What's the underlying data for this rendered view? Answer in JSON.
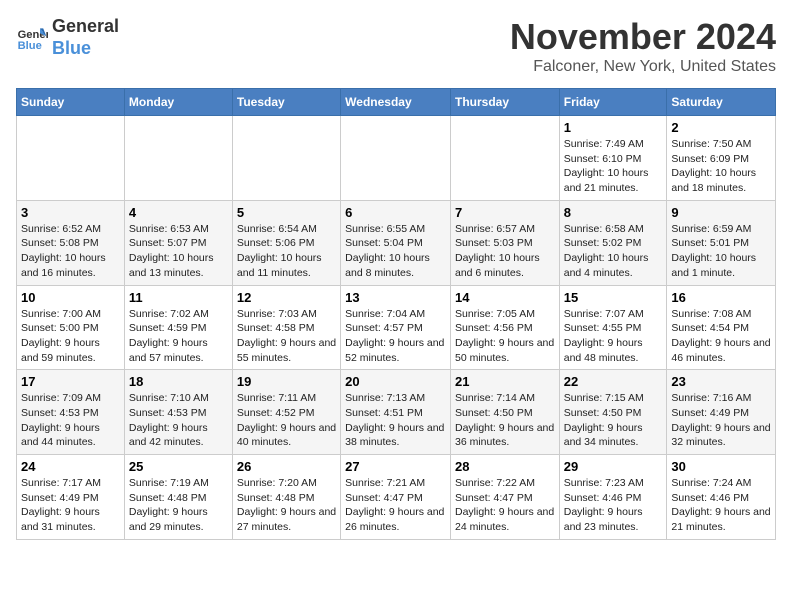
{
  "header": {
    "logo_line1": "General",
    "logo_line2": "Blue",
    "month": "November 2024",
    "location": "Falconer, New York, United States"
  },
  "weekdays": [
    "Sunday",
    "Monday",
    "Tuesday",
    "Wednesday",
    "Thursday",
    "Friday",
    "Saturday"
  ],
  "weeks": [
    [
      {
        "day": "",
        "info": ""
      },
      {
        "day": "",
        "info": ""
      },
      {
        "day": "",
        "info": ""
      },
      {
        "day": "",
        "info": ""
      },
      {
        "day": "",
        "info": ""
      },
      {
        "day": "1",
        "info": "Sunrise: 7:49 AM\nSunset: 6:10 PM\nDaylight: 10 hours and 21 minutes."
      },
      {
        "day": "2",
        "info": "Sunrise: 7:50 AM\nSunset: 6:09 PM\nDaylight: 10 hours and 18 minutes."
      }
    ],
    [
      {
        "day": "3",
        "info": "Sunrise: 6:52 AM\nSunset: 5:08 PM\nDaylight: 10 hours and 16 minutes."
      },
      {
        "day": "4",
        "info": "Sunrise: 6:53 AM\nSunset: 5:07 PM\nDaylight: 10 hours and 13 minutes."
      },
      {
        "day": "5",
        "info": "Sunrise: 6:54 AM\nSunset: 5:06 PM\nDaylight: 10 hours and 11 minutes."
      },
      {
        "day": "6",
        "info": "Sunrise: 6:55 AM\nSunset: 5:04 PM\nDaylight: 10 hours and 8 minutes."
      },
      {
        "day": "7",
        "info": "Sunrise: 6:57 AM\nSunset: 5:03 PM\nDaylight: 10 hours and 6 minutes."
      },
      {
        "day": "8",
        "info": "Sunrise: 6:58 AM\nSunset: 5:02 PM\nDaylight: 10 hours and 4 minutes."
      },
      {
        "day": "9",
        "info": "Sunrise: 6:59 AM\nSunset: 5:01 PM\nDaylight: 10 hours and 1 minute."
      }
    ],
    [
      {
        "day": "10",
        "info": "Sunrise: 7:00 AM\nSunset: 5:00 PM\nDaylight: 9 hours and 59 minutes."
      },
      {
        "day": "11",
        "info": "Sunrise: 7:02 AM\nSunset: 4:59 PM\nDaylight: 9 hours and 57 minutes."
      },
      {
        "day": "12",
        "info": "Sunrise: 7:03 AM\nSunset: 4:58 PM\nDaylight: 9 hours and 55 minutes."
      },
      {
        "day": "13",
        "info": "Sunrise: 7:04 AM\nSunset: 4:57 PM\nDaylight: 9 hours and 52 minutes."
      },
      {
        "day": "14",
        "info": "Sunrise: 7:05 AM\nSunset: 4:56 PM\nDaylight: 9 hours and 50 minutes."
      },
      {
        "day": "15",
        "info": "Sunrise: 7:07 AM\nSunset: 4:55 PM\nDaylight: 9 hours and 48 minutes."
      },
      {
        "day": "16",
        "info": "Sunrise: 7:08 AM\nSunset: 4:54 PM\nDaylight: 9 hours and 46 minutes."
      }
    ],
    [
      {
        "day": "17",
        "info": "Sunrise: 7:09 AM\nSunset: 4:53 PM\nDaylight: 9 hours and 44 minutes."
      },
      {
        "day": "18",
        "info": "Sunrise: 7:10 AM\nSunset: 4:53 PM\nDaylight: 9 hours and 42 minutes."
      },
      {
        "day": "19",
        "info": "Sunrise: 7:11 AM\nSunset: 4:52 PM\nDaylight: 9 hours and 40 minutes."
      },
      {
        "day": "20",
        "info": "Sunrise: 7:13 AM\nSunset: 4:51 PM\nDaylight: 9 hours and 38 minutes."
      },
      {
        "day": "21",
        "info": "Sunrise: 7:14 AM\nSunset: 4:50 PM\nDaylight: 9 hours and 36 minutes."
      },
      {
        "day": "22",
        "info": "Sunrise: 7:15 AM\nSunset: 4:50 PM\nDaylight: 9 hours and 34 minutes."
      },
      {
        "day": "23",
        "info": "Sunrise: 7:16 AM\nSunset: 4:49 PM\nDaylight: 9 hours and 32 minutes."
      }
    ],
    [
      {
        "day": "24",
        "info": "Sunrise: 7:17 AM\nSunset: 4:49 PM\nDaylight: 9 hours and 31 minutes."
      },
      {
        "day": "25",
        "info": "Sunrise: 7:19 AM\nSunset: 4:48 PM\nDaylight: 9 hours and 29 minutes."
      },
      {
        "day": "26",
        "info": "Sunrise: 7:20 AM\nSunset: 4:48 PM\nDaylight: 9 hours and 27 minutes."
      },
      {
        "day": "27",
        "info": "Sunrise: 7:21 AM\nSunset: 4:47 PM\nDaylight: 9 hours and 26 minutes."
      },
      {
        "day": "28",
        "info": "Sunrise: 7:22 AM\nSunset: 4:47 PM\nDaylight: 9 hours and 24 minutes."
      },
      {
        "day": "29",
        "info": "Sunrise: 7:23 AM\nSunset: 4:46 PM\nDaylight: 9 hours and 23 minutes."
      },
      {
        "day": "30",
        "info": "Sunrise: 7:24 AM\nSunset: 4:46 PM\nDaylight: 9 hours and 21 minutes."
      }
    ]
  ]
}
